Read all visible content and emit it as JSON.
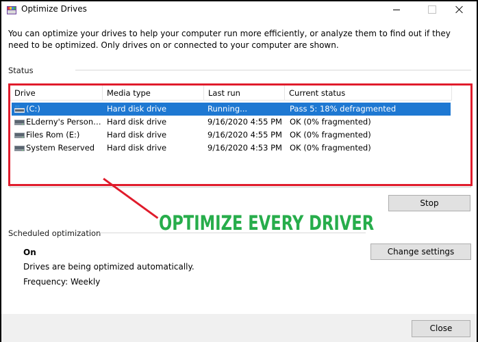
{
  "window": {
    "title": "Optimize Drives",
    "icon": "defrag-app-icon"
  },
  "intro_text": "You can optimize your drives to help your computer run more efficiently, or analyze them to find out if they need to be optimized. Only drives on or connected to your computer are shown.",
  "status": {
    "section_label": "Status",
    "columns": [
      "Drive",
      "Media type",
      "Last run",
      "Current status"
    ],
    "rows": [
      {
        "drive": "(C:)",
        "media_type": "Hard disk drive",
        "last_run": "Running...",
        "current_status": "Pass 5: 18% defragmented",
        "selected": true,
        "icon": "system-drive-icon"
      },
      {
        "drive": "ELderny's Personal ...",
        "media_type": "Hard disk drive",
        "last_run": "9/16/2020 4:55 PM",
        "current_status": "OK (0% fragmented)",
        "selected": false,
        "icon": "hard-drive-icon"
      },
      {
        "drive": "Files Rom (E:)",
        "media_type": "Hard disk drive",
        "last_run": "9/16/2020 4:55 PM",
        "current_status": "OK (0% fragmented)",
        "selected": false,
        "icon": "hard-drive-icon"
      },
      {
        "drive": "System Reserved",
        "media_type": "Hard disk drive",
        "last_run": "9/16/2020 4:53 PM",
        "current_status": "OK (0% fragmented)",
        "selected": false,
        "icon": "hard-drive-icon"
      }
    ],
    "stop_button": "Stop"
  },
  "annotation": {
    "text": "OPTIMIZE EVERY DRIVER",
    "color": "#27ad4b",
    "highlight_color": "#e01b2b"
  },
  "scheduled": {
    "section_label": "Scheduled optimization",
    "state": "On",
    "description": "Drives are being optimized automatically.",
    "frequency": "Frequency: Weekly",
    "change_button": "Change settings"
  },
  "close_button": "Close",
  "colors": {
    "selection": "#1e78d2",
    "button_bg": "#e1e1e1",
    "footer_bg": "#f0f0f0"
  }
}
